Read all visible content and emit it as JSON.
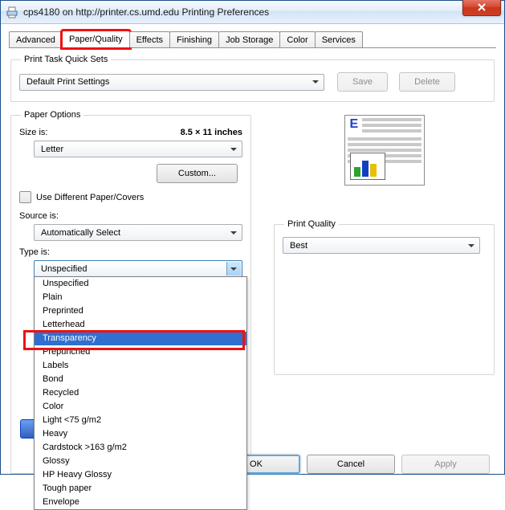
{
  "window": {
    "title": "cps4180 on http://printer.cs.umd.edu Printing Preferences"
  },
  "tabs": [
    "Advanced",
    "Paper/Quality",
    "Effects",
    "Finishing",
    "Job Storage",
    "Color",
    "Services"
  ],
  "quickSets": {
    "legend": "Print Task Quick Sets",
    "value": "Default Print Settings",
    "save": "Save",
    "delete": "Delete"
  },
  "paperOptions": {
    "legend": "Paper Options",
    "sizeLabel": "Size is:",
    "sizeValue": "8.5 × 11 inches",
    "sizeSelected": "Letter",
    "customBtn": "Custom...",
    "diffPaper": "Use Different Paper/Covers",
    "sourceLabel": "Source is:",
    "sourceSelected": "Automatically Select",
    "typeLabel": "Type is:",
    "typeSelected": "Unspecified",
    "typeOptions": [
      "Unspecified",
      "Plain",
      "Preprinted",
      "Letterhead",
      "Transparency",
      "Prepunched",
      "Labels",
      "Bond",
      "Recycled",
      "Color",
      "Light <75 g/m2",
      "Heavy",
      "Cardstock >163 g/m2",
      "Glossy",
      "HP Heavy Glossy",
      "Tough paper",
      "Envelope"
    ],
    "typeHighlighted": "Transparency"
  },
  "printQuality": {
    "legend": "Print Quality",
    "value": "Best"
  },
  "dialog": {
    "ok": "OK",
    "cancel": "Cancel",
    "apply": "Apply"
  }
}
